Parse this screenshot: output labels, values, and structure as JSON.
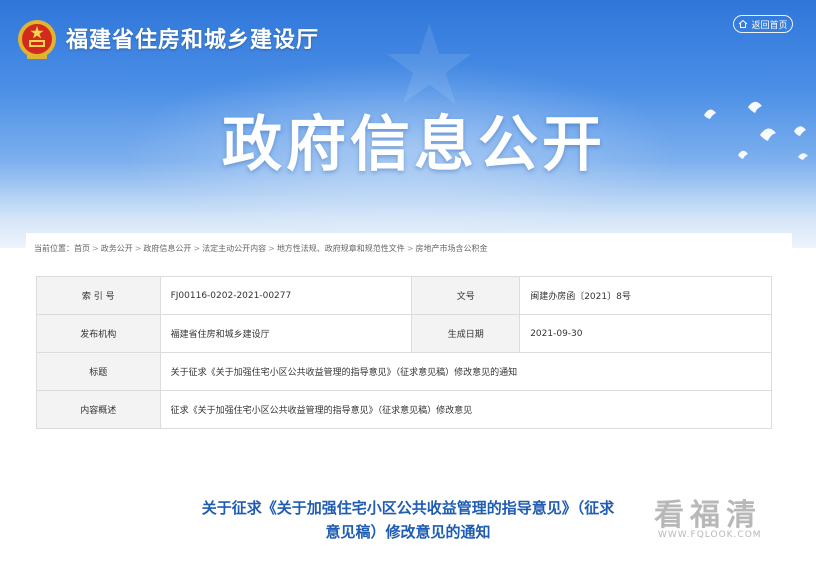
{
  "header": {
    "site_title": "福建省住房和城乡建设厅",
    "back_label": "返回首页",
    "banner_title": "政府信息公开"
  },
  "breadcrumb": {
    "prefix": "当前位置：",
    "items": [
      "首页",
      "政务公开",
      "政府信息公开",
      "法定主动公开内容",
      "地方性法规、政府规章和规范性文件",
      "房地产市场含公积金"
    ],
    "separator": ">"
  },
  "meta": {
    "index_label": "索 引 号",
    "index_value": "FJ00116-0202-2021-00277",
    "docno_label": "文号",
    "docno_value": "闽建办房函〔2021〕8号",
    "issuer_label": "发布机构",
    "issuer_value": "福建省住房和城乡建设厅",
    "date_label": "生成日期",
    "date_value": "2021-09-30",
    "title_label": "标题",
    "title_value": "关于征求《关于加强住宅小区公共收益管理的指导意见》（征求意见稿）修改意见的通知",
    "summary_label": "内容概述",
    "summary_value": "征求《关于加强住宅小区公共收益管理的指导意见》（征求意见稿）修改意见"
  },
  "document": {
    "title_line1": "关于征求《关于加强住宅小区公共收益管理的指导意见》（征求",
    "title_line2": "意见稿）修改意见的通知"
  },
  "watermark": {
    "text": "看福清",
    "url": "WWW.FQLOOK.COM"
  },
  "colors": {
    "banner_top": "#2f76d9",
    "title_blue": "#1f5cb3",
    "label_bg": "#f3f3f3"
  }
}
